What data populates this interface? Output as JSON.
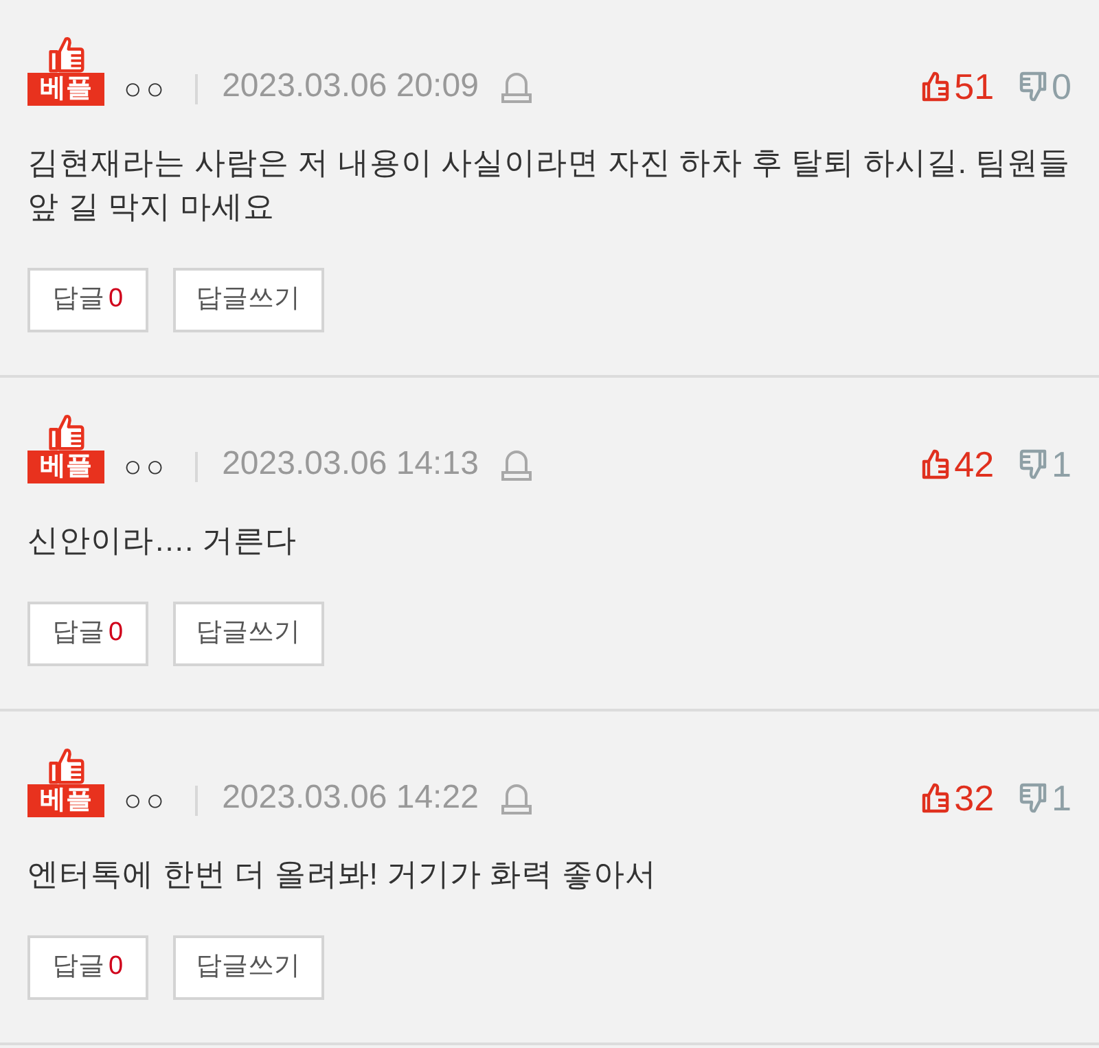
{
  "comments": [
    {
      "badge": "베플",
      "author": "○○",
      "date": "2023.03.06 20:09",
      "likes": "51",
      "dislikes": "0",
      "text": "김현재라는 사람은 저 내용이 사실이라면 자진 하차 후 탈퇴 하시길. 팀원들 앞 길 막지 마세요",
      "reply_label": "답글",
      "reply_count": "0",
      "write_reply": "답글쓰기"
    },
    {
      "badge": "베플",
      "author": "○○",
      "date": "2023.03.06 14:13",
      "likes": "42",
      "dislikes": "1",
      "text": "신안이라…. 거른다",
      "reply_label": "답글",
      "reply_count": "0",
      "write_reply": "답글쓰기"
    },
    {
      "badge": "베플",
      "author": "○○",
      "date": "2023.03.06 14:22",
      "likes": "32",
      "dislikes": "1",
      "text": "엔터톡에 한번 더 올려봐! 거기가 화력 좋아서",
      "reply_label": "답글",
      "reply_count": "0",
      "write_reply": "답글쓰기"
    }
  ]
}
